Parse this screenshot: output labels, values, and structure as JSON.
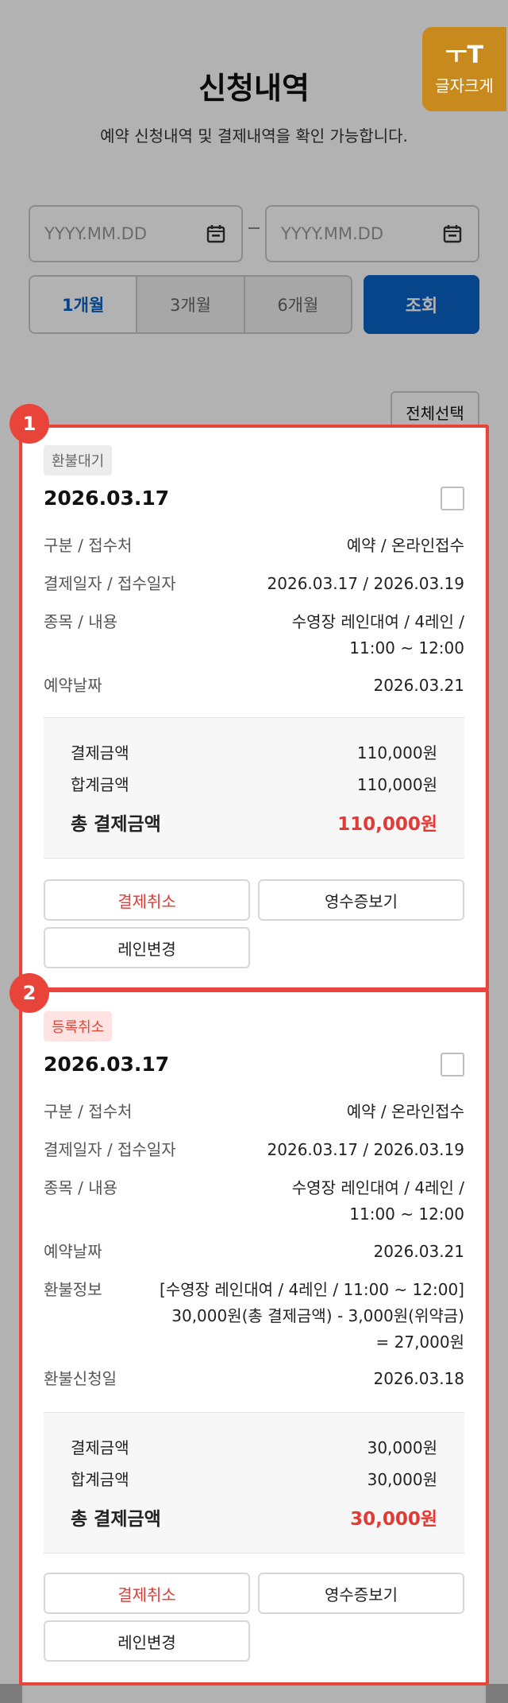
{
  "header": {
    "title": "신청내역",
    "subtitle": "예약 신청내역 및 결제내역을 확인 가능합니다.",
    "font_size_button": {
      "icon": "ㅜT",
      "label": "글자크게"
    }
  },
  "filters": {
    "start_date_placeholder": "YYYY.MM.DD",
    "end_date_placeholder": "YYYY.MM.DD",
    "date_separator": "-",
    "periods": [
      {
        "label": "1개월",
        "active": true
      },
      {
        "label": "3개월",
        "active": false
      },
      {
        "label": "6개월",
        "active": false
      }
    ],
    "search_label": "조회"
  },
  "select_all_label": "전체선택",
  "records": [
    {
      "marker": "1",
      "status": "환불대기",
      "date": "2026.03.17",
      "rows": [
        {
          "label": "구분 / 접수처",
          "value": "예약 / 온라인접수"
        },
        {
          "label": "결제일자 / 접수일자",
          "value": "2026.03.17 / 2026.03.19"
        },
        {
          "label": "종목 / 내용",
          "value": "수영장 레인대여 / 4레인 /",
          "value2": "11:00 ~ 12:00"
        },
        {
          "label": "예약날짜",
          "value": "2026.03.21"
        }
      ],
      "summary": [
        {
          "label": "결제금액",
          "value": "110,000원"
        },
        {
          "label": "합계금액",
          "value": "110,000원"
        },
        {
          "label": "총 결제금액",
          "value": "110,000원"
        }
      ],
      "buttons": {
        "cancel": "결제취소",
        "receipt": "영수증보기",
        "change": "레인변경"
      }
    },
    {
      "marker": "2",
      "status": "등록취소",
      "date": "2026.03.17",
      "rows": [
        {
          "label": "구분 / 접수처",
          "value": "예약 / 온라인접수"
        },
        {
          "label": "결제일자 / 접수일자",
          "value": "2026.03.17 / 2026.03.19"
        },
        {
          "label": "종목 / 내용",
          "value": "수영장 레인대여 / 4레인 /",
          "value2": "11:00 ~ 12:00"
        },
        {
          "label": "예약날짜",
          "value": "2026.03.21"
        },
        {
          "label": "환불정보",
          "value": "[수영장 레인대여 / 4레인 / 11:00 ~ 12:00]",
          "value2": "30,000원(총 결제금액) - 3,000원(위약금)",
          "value3": "= 27,000원"
        },
        {
          "label": "환불신청일",
          "value": "2026.03.18"
        }
      ],
      "summary": [
        {
          "label": "결제금액",
          "value": "30,000원"
        },
        {
          "label": "합계금액",
          "value": "30,000원"
        },
        {
          "label": "총 결제금액",
          "value": "30,000원"
        }
      ],
      "buttons": {
        "cancel": "결제취소",
        "receipt": "영수증보기",
        "change": "레인변경"
      }
    }
  ],
  "colors": {
    "primary_blue": "#0b63c7",
    "accent_red": "#e53935",
    "highlight_red": "#e8443a",
    "font_button_orange": "#c98a1d"
  }
}
